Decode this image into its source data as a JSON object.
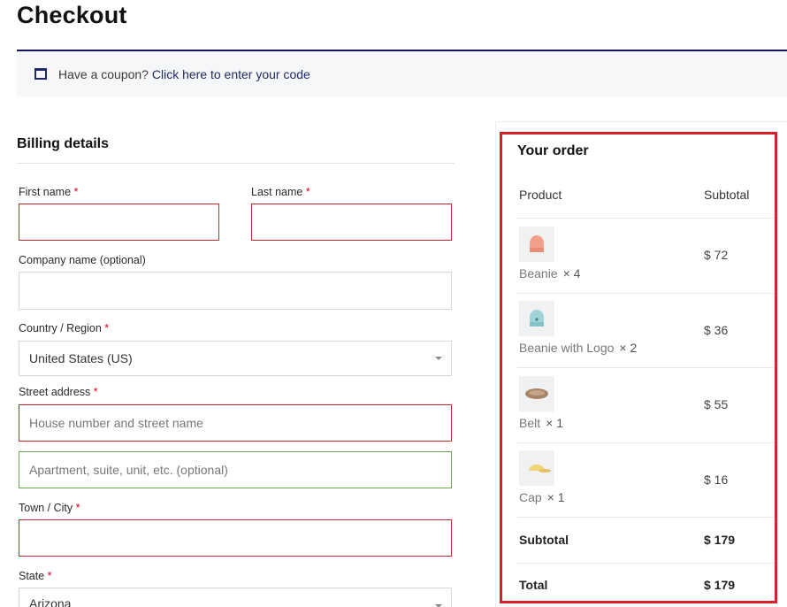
{
  "page": {
    "title": "Checkout"
  },
  "coupon": {
    "prompt": "Have a coupon?",
    "link": "Click here to enter your code"
  },
  "billing": {
    "heading": "Billing details",
    "required_mark": "*",
    "first_name": {
      "label": "First name",
      "value": ""
    },
    "last_name": {
      "label": "Last name",
      "value": ""
    },
    "company": {
      "label": "Company name (optional)",
      "value": ""
    },
    "country": {
      "label": "Country / Region",
      "value": "United States (US)"
    },
    "street": {
      "label": "Street address",
      "placeholder1": "House number and street name",
      "placeholder2": "Apartment, suite, unit, etc. (optional)"
    },
    "city": {
      "label": "Town / City",
      "value": ""
    },
    "state": {
      "label": "State",
      "value": "Arizona"
    }
  },
  "order": {
    "heading": "Your order",
    "col_product": "Product",
    "col_subtotal": "Subtotal",
    "items": [
      {
        "name": "Beanie",
        "qty": "× 4",
        "price": "$ 72",
        "icon": "beanie-icon",
        "color": "#f0a08a"
      },
      {
        "name": "Beanie with Logo",
        "qty": "× 2",
        "price": "$ 36",
        "icon": "beanie-icon",
        "color": "#9fd3d9"
      },
      {
        "name": "Belt",
        "qty": "× 1",
        "price": "$ 55",
        "icon": "belt-icon",
        "color": "#a88466"
      },
      {
        "name": "Cap",
        "qty": "× 1",
        "price": "$ 16",
        "icon": "cap-icon",
        "color": "#f1d77a"
      }
    ],
    "subtotal_label": "Subtotal",
    "subtotal_value": "$ 179",
    "total_label": "Total",
    "total_value": "$ 179"
  },
  "colors": {
    "accent": "#1f2a66",
    "error": "#c1272d",
    "highlight_box": "#d6202a",
    "valid": "#6aa84f"
  }
}
